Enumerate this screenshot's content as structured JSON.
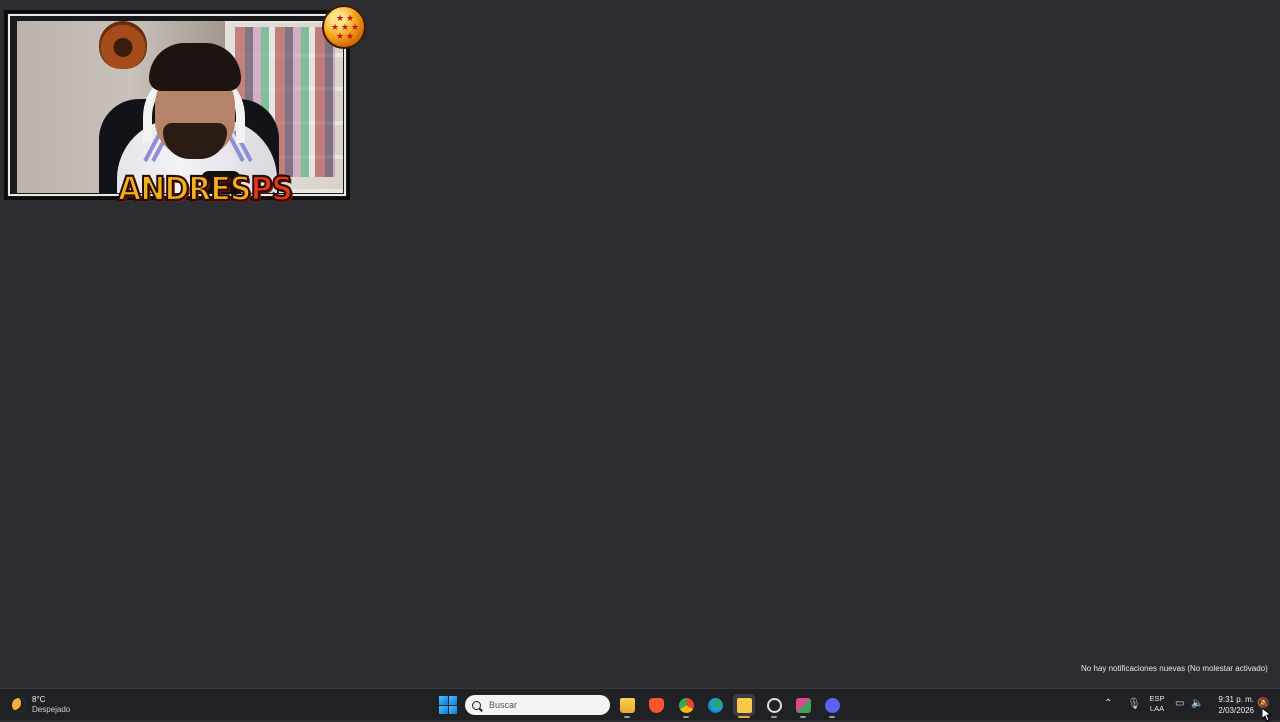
{
  "webcam": {
    "streamer_name_main": "ANDRES",
    "streamer_name_accent": "PS"
  },
  "notification_tooltip": "No hay notificaciones nuevas  (No molestar activado)",
  "taskbar": {
    "weather": {
      "temp": "8°C",
      "desc": "Despejado",
      "icon": "moon-icon"
    },
    "search": {
      "placeholder": "Buscar"
    },
    "apps": [
      {
        "name": "file-explorer",
        "color": "#f5c342"
      },
      {
        "name": "brave-browser",
        "color": "#fb542b"
      },
      {
        "name": "chrome-browser",
        "color": "#34a853"
      },
      {
        "name": "edge-browser",
        "color": "#1fa0e0"
      },
      {
        "name": "sticky-notes",
        "color": "#f7c948",
        "active": true
      },
      {
        "name": "obs-studio",
        "color": "#d9d9d9"
      },
      {
        "name": "game-app",
        "color": "#d84a8a"
      },
      {
        "name": "discord",
        "color": "#5865f2"
      }
    ],
    "language": {
      "line1": "ESP",
      "line2": "LAA"
    },
    "clock": {
      "time": "9:31 p. m.",
      "date": "2/03/2026"
    }
  }
}
